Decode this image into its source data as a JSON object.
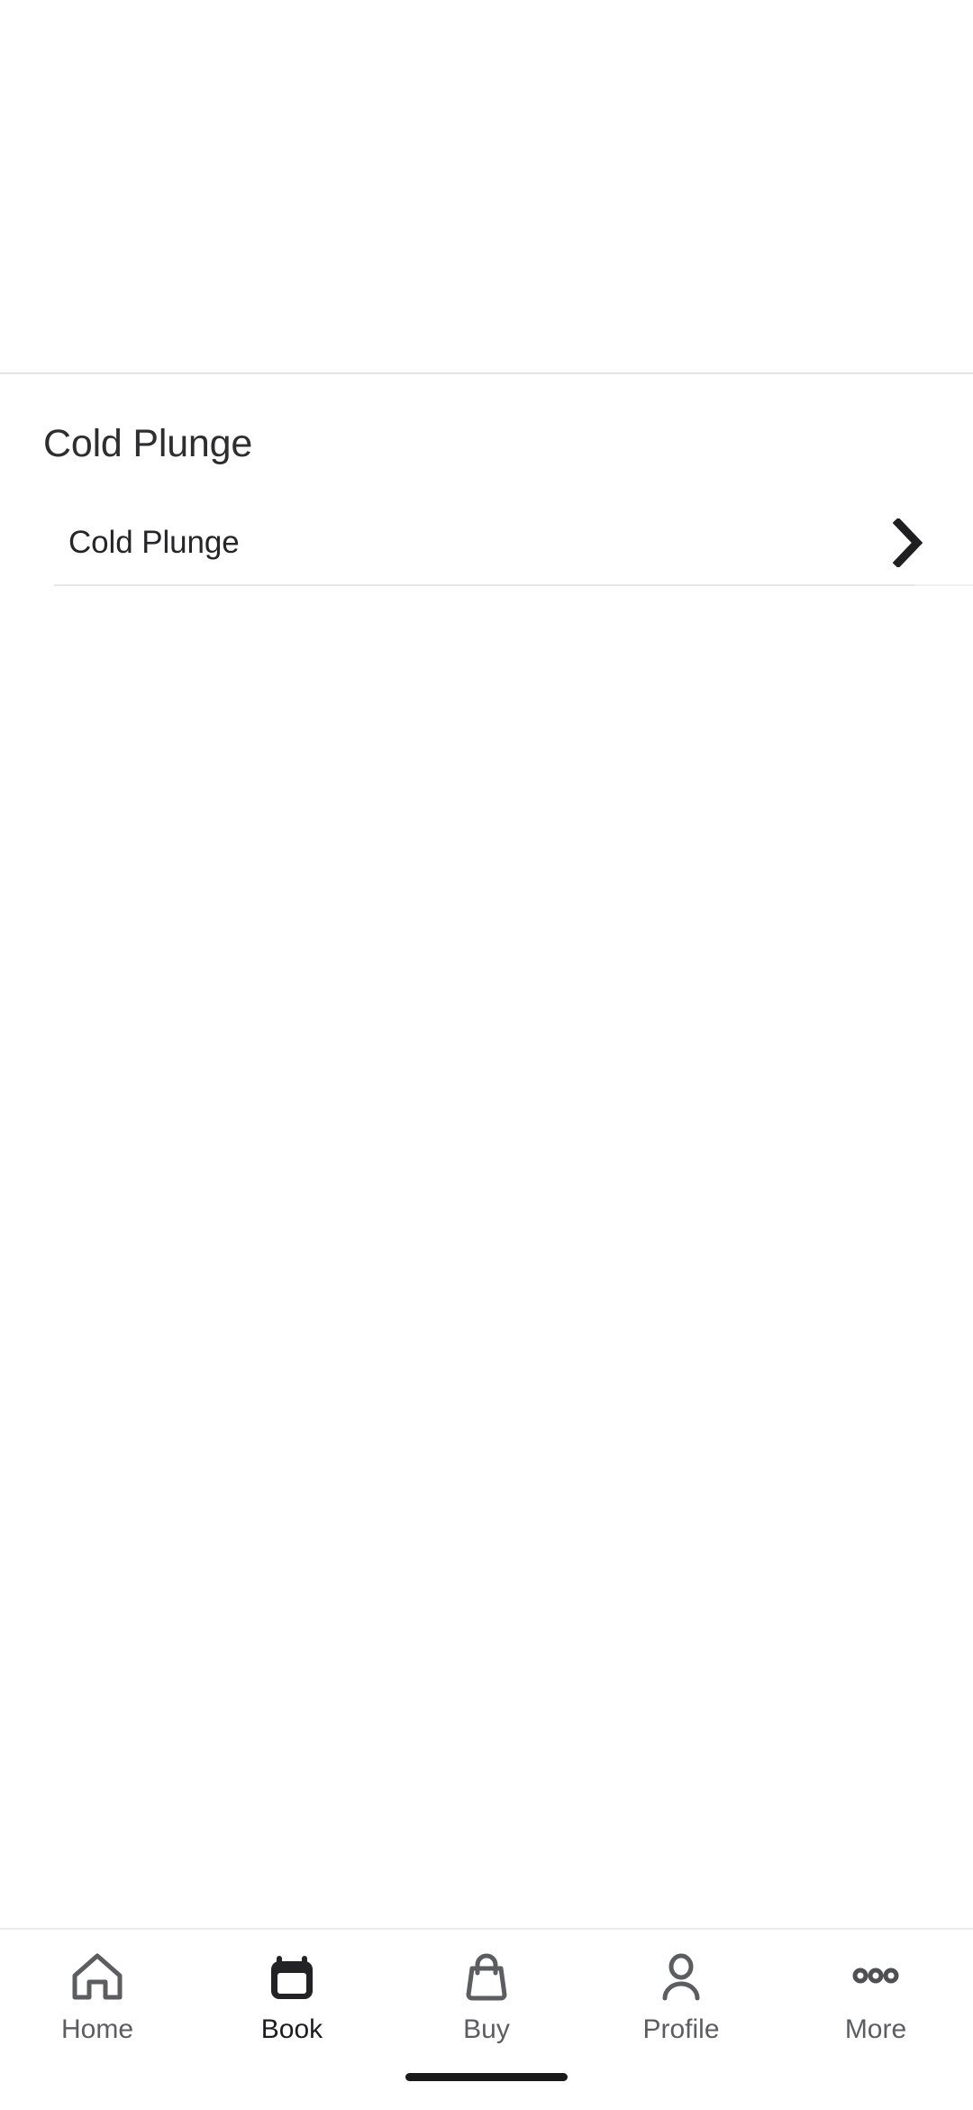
{
  "screen": {
    "background_color": "#ffffff",
    "divider_color": "#e3e3e5"
  },
  "content": {
    "section_header": "Cold Plunge",
    "list": [
      {
        "label": "Cold Plunge",
        "accessory_icon": "chevron-right-icon"
      }
    ]
  },
  "bottom_nav": {
    "active_index": 1,
    "active_color": "#1d1d1f",
    "inactive_color": "#5c5d61",
    "items": [
      {
        "label": "Home",
        "icon": "home-icon",
        "active": false
      },
      {
        "label": "Book",
        "icon": "calendar-icon",
        "active": true
      },
      {
        "label": "Buy",
        "icon": "bag-icon",
        "active": false
      },
      {
        "label": "Profile",
        "icon": "person-icon",
        "active": false
      },
      {
        "label": "More",
        "icon": "ellipsis-icon",
        "active": false
      }
    ]
  },
  "system": {
    "home_indicator": "home-indicator-bar"
  }
}
